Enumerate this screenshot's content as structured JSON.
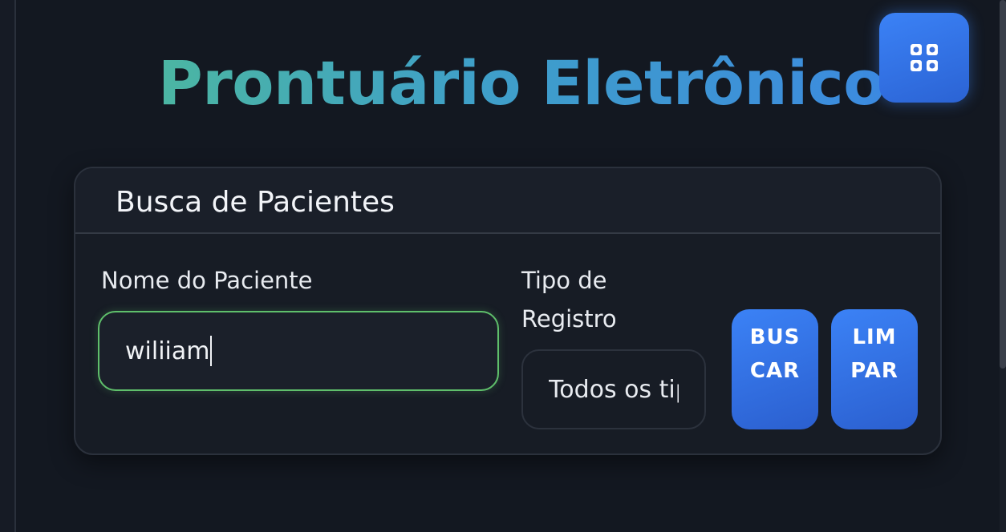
{
  "app": {
    "title": "Prontuário Eletrônico"
  },
  "menu_button": {
    "icon": "grid-icon"
  },
  "search_card": {
    "title": "Busca de Pacientes",
    "name_field": {
      "label": "Nome do Paciente",
      "value": "wiliiam"
    },
    "type_field": {
      "label": "Tipo de Registro",
      "selected": "Todos os tipos"
    },
    "buttons": {
      "search_label": "BUSCAR",
      "clear_label": "LIMPAR"
    }
  },
  "colors": {
    "accent_blue": "#3b82f6",
    "accent_green": "#5fbf6b",
    "background": "#131821",
    "card": "#171c25"
  }
}
